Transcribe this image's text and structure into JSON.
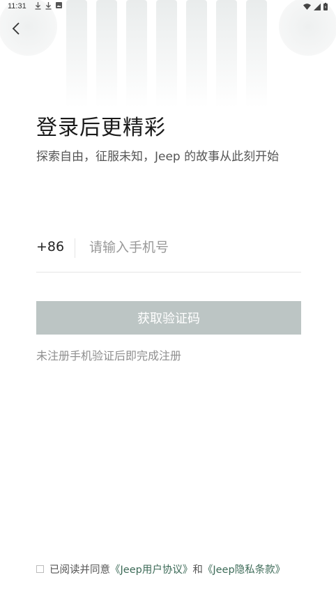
{
  "status_bar": {
    "time": "11:31"
  },
  "header": {
    "back_icon": "chevron-left-icon"
  },
  "login": {
    "title": "登录后更精彩",
    "subtitle": "探索自由，征服未知，Jeep 的故事从此刻开始",
    "country_code": "+86",
    "phone_placeholder": "请输入手机号",
    "get_code_label": "获取验证码",
    "hint": "未注册手机验证后即完成注册"
  },
  "agreement": {
    "prefix": "已阅读并同意",
    "user_agreement": "《Jeep用户协议》",
    "conjunction": "和",
    "privacy_policy": "《Jeep隐私条款》"
  },
  "colors": {
    "accent_link": "#3c6a57",
    "button_disabled": "#bcc5c4",
    "text_primary": "#1a1a1a",
    "text_hint": "#8e8e8e"
  }
}
